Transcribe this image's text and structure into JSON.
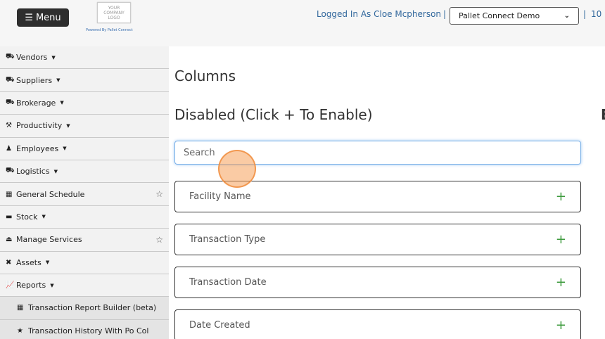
{
  "header": {
    "menu_label": "Menu",
    "logo_text": "YOUR COMPANY LOGO",
    "powered_by": "Powered By Pallet Connect",
    "logged_in": "Logged In As Cloe Mcpherson",
    "separator": "|",
    "company_select": "Pallet Connect Demo",
    "right_text": "10"
  },
  "sidebar": {
    "items": [
      {
        "label": "Vendors",
        "icon": "truck-icon",
        "caret": true
      },
      {
        "label": "Suppliers",
        "icon": "truck-loading-icon",
        "caret": true
      },
      {
        "label": "Brokerage",
        "icon": "shipping-icon",
        "caret": true
      },
      {
        "label": "Productivity",
        "icon": "hammer-icon",
        "caret": true
      },
      {
        "label": "Employees",
        "icon": "person-icon",
        "caret": true
      },
      {
        "label": "Logistics",
        "icon": "truck-icon",
        "caret": true
      },
      {
        "label": "General Schedule",
        "icon": "calendar-icon",
        "star": true
      },
      {
        "label": "Stock",
        "icon": "pallet-icon",
        "caret": true
      },
      {
        "label": "Manage Services",
        "icon": "eject-icon",
        "star": true
      },
      {
        "label": "Assets",
        "icon": "tools-icon",
        "caret": true
      },
      {
        "label": "Reports",
        "icon": "chart-line-icon",
        "caret": true
      }
    ],
    "subitems": [
      {
        "label": "Transaction Report Builder (beta)",
        "icon": "table-icon"
      },
      {
        "label": "Transaction History With Po Col",
        "icon": "star-icon"
      }
    ]
  },
  "main": {
    "title": "Columns",
    "disabled_title": "Disabled (Click + To Enable)",
    "cut_title": "E",
    "search_placeholder": "Search",
    "columns": [
      {
        "label": "Facility Name"
      },
      {
        "label": "Transaction Type"
      },
      {
        "label": "Transaction Date"
      },
      {
        "label": "Date Created"
      }
    ],
    "plus": "+"
  }
}
